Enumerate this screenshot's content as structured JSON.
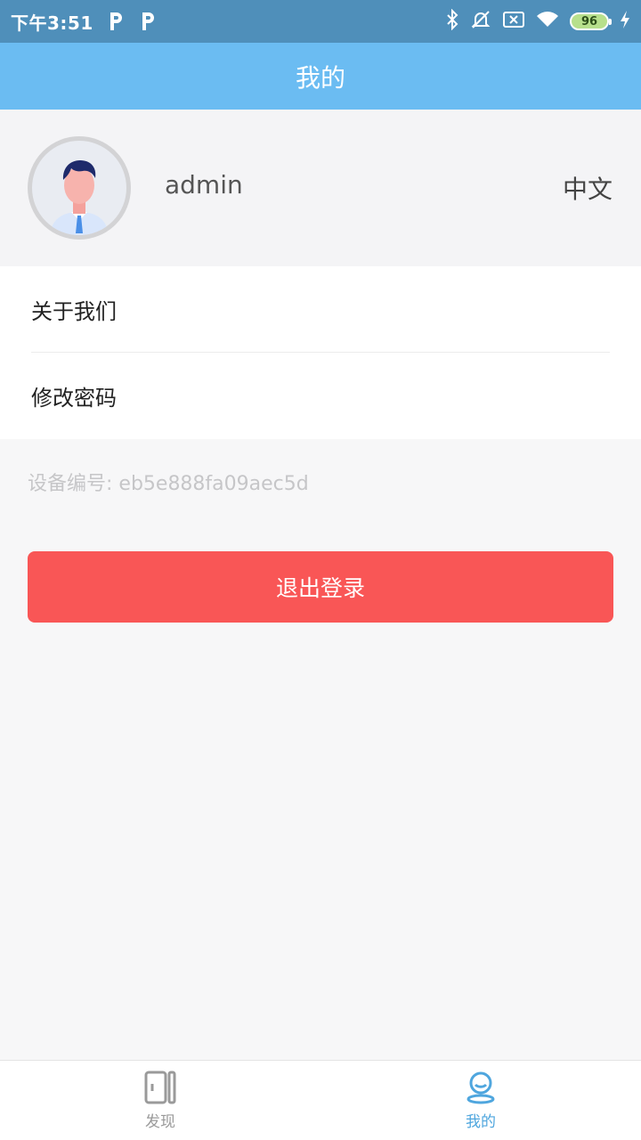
{
  "status_bar": {
    "time": "下午3:51",
    "battery": "96",
    "icons": [
      "p-app-icon",
      "p-app-icon",
      "bluetooth-icon",
      "mute-bell-icon",
      "no-sim-icon",
      "wifi-icon",
      "battery-icon",
      "charging-icon"
    ]
  },
  "header": {
    "title": "我的"
  },
  "profile": {
    "username": "admin",
    "language": "中文"
  },
  "menu": {
    "items": [
      {
        "label": "关于我们"
      },
      {
        "label": "修改密码"
      }
    ]
  },
  "device": {
    "label": "设备编号: eb5e888fa09aec5d"
  },
  "actions": {
    "logout_label": "退出登录"
  },
  "tabbar": {
    "tabs": [
      {
        "label": "发现",
        "icon": "discover-icon",
        "active": false
      },
      {
        "label": "我的",
        "icon": "profile-icon",
        "active": true
      }
    ]
  },
  "colors": {
    "status_bar": "#4f8fba",
    "header": "#6bbcf2",
    "logout_button": "#f95656",
    "active_tab": "#4fa6de"
  }
}
